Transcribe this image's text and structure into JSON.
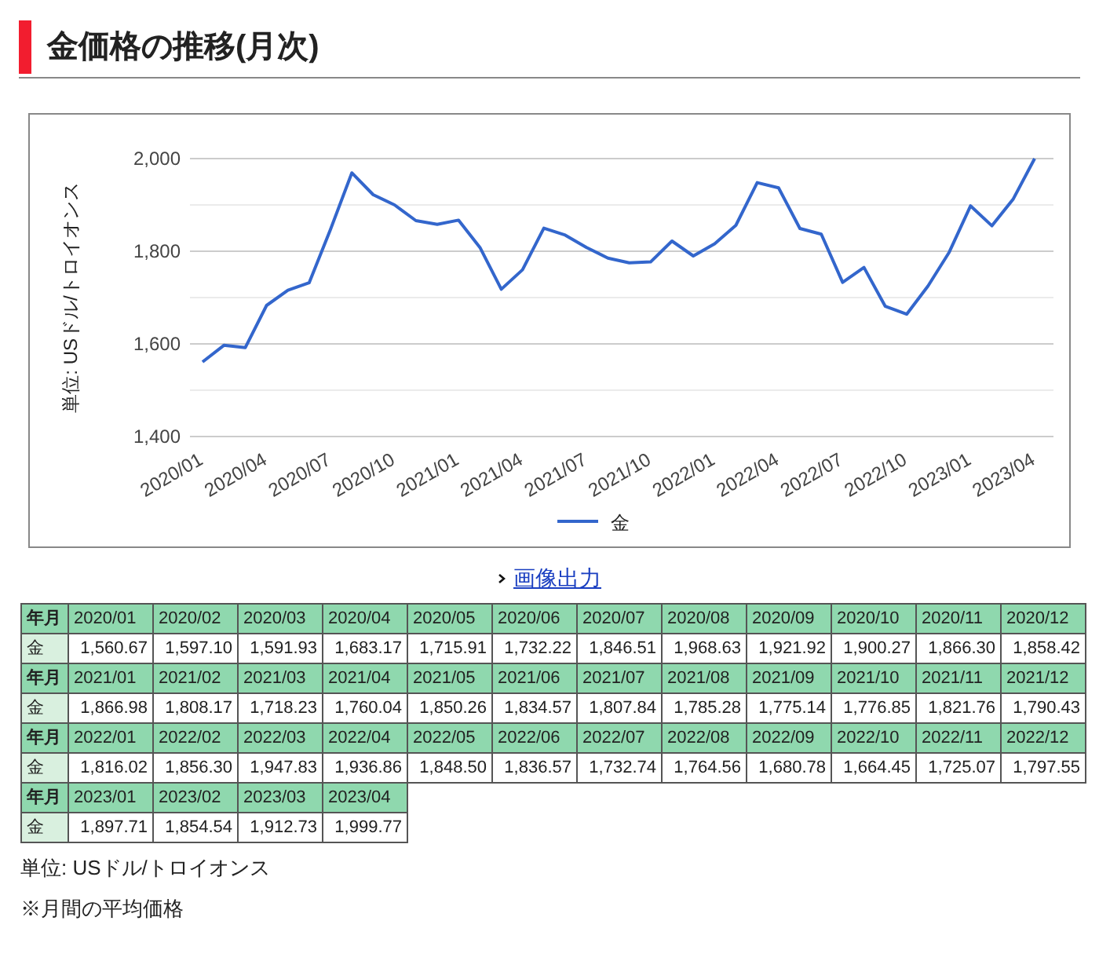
{
  "title": "金価格の推移(月次)",
  "chart": {
    "chart_data": {
      "type": "line",
      "ylabel": "単位: USドル/トロイオンス",
      "categories": [
        "2020/01",
        null,
        null,
        "2020/04",
        null,
        null,
        "2020/07",
        null,
        null,
        "2020/10",
        null,
        null,
        "2021/01",
        null,
        null,
        "2021/04",
        null,
        null,
        "2021/07",
        null,
        null,
        "2021/10",
        null,
        null,
        "2022/01",
        null,
        null,
        "2022/04",
        null,
        null,
        "2022/07",
        null,
        null,
        "2022/10",
        null,
        null,
        "2023/01",
        null,
        null,
        "2023/04"
      ],
      "series": [
        {
          "name": "金",
          "color": "#3366cc",
          "values": [
            1561,
            1597,
            1592,
            1683,
            1716,
            1732,
            1847,
            1969,
            1922,
            1900,
            1866,
            1858,
            1867,
            1808,
            1718,
            1760,
            1850,
            1835,
            1808,
            1785,
            1775,
            1777,
            1822,
            1790,
            1816,
            1856,
            1948,
            1937,
            1849,
            1837,
            1733,
            1765,
            1681,
            1664,
            1725,
            1798,
            1898,
            1855,
            1913,
            2000
          ]
        }
      ],
      "ylim": [
        1400,
        2000
      ],
      "yticks": [
        {
          "value": 1400,
          "label": "1,400"
        },
        {
          "value": 1600,
          "label": "1,600"
        },
        {
          "value": 1800,
          "label": "1,800"
        },
        {
          "value": 2000,
          "label": "2,000"
        }
      ]
    }
  },
  "export_link": "画像出力",
  "table": {
    "blocks": [
      {
        "header_label": "年月",
        "row_label": "金",
        "months": [
          "2020/01",
          "2020/02",
          "2020/03",
          "2020/04",
          "2020/05",
          "2020/06",
          "2020/07",
          "2020/08",
          "2020/09",
          "2020/10",
          "2020/11",
          "2020/12"
        ],
        "values": [
          "1,560.67",
          "1,597.10",
          "1,591.93",
          "1,683.17",
          "1,715.91",
          "1,732.22",
          "1,846.51",
          "1,968.63",
          "1,921.92",
          "1,900.27",
          "1,866.30",
          "1,858.42"
        ]
      },
      {
        "header_label": "年月",
        "row_label": "金",
        "months": [
          "2021/01",
          "2021/02",
          "2021/03",
          "2021/04",
          "2021/05",
          "2021/06",
          "2021/07",
          "2021/08",
          "2021/09",
          "2021/10",
          "2021/11",
          "2021/12"
        ],
        "values": [
          "1,866.98",
          "1,808.17",
          "1,718.23",
          "1,760.04",
          "1,850.26",
          "1,834.57",
          "1,807.84",
          "1,785.28",
          "1,775.14",
          "1,776.85",
          "1,821.76",
          "1,790.43"
        ]
      },
      {
        "header_label": "年月",
        "row_label": "金",
        "months": [
          "2022/01",
          "2022/02",
          "2022/03",
          "2022/04",
          "2022/05",
          "2022/06",
          "2022/07",
          "2022/08",
          "2022/09",
          "2022/10",
          "2022/11",
          "2022/12"
        ],
        "values": [
          "1,816.02",
          "1,856.30",
          "1,947.83",
          "1,936.86",
          "1,848.50",
          "1,836.57",
          "1,732.74",
          "1,764.56",
          "1,680.78",
          "1,664.45",
          "1,725.07",
          "1,797.55"
        ]
      },
      {
        "header_label": "年月",
        "row_label": "金",
        "months": [
          "2023/01",
          "2023/02",
          "2023/03",
          "2023/04"
        ],
        "values": [
          "1,897.71",
          "1,854.54",
          "1,912.73",
          "1,999.77"
        ]
      }
    ]
  },
  "notes": [
    "単位: USドル/トロイオンス",
    "※月間の平均価格"
  ]
}
